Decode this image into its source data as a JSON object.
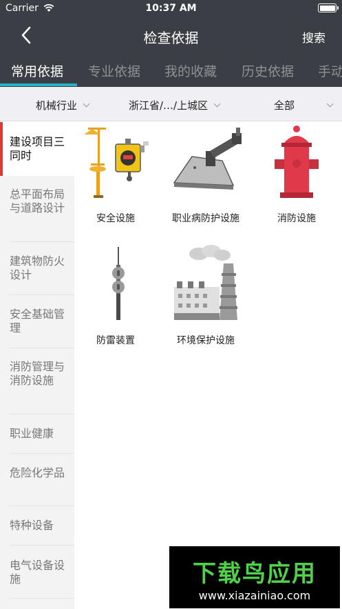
{
  "status": {
    "carrier": "Carrier",
    "time": "10:37 AM"
  },
  "nav": {
    "title": "检查依据",
    "search": "搜索"
  },
  "tabs": [
    "常用依据",
    "专业依据",
    "我的收藏",
    "历史依据",
    "手动"
  ],
  "filters": [
    "机械行业",
    "浙江省/…/上城区",
    "全部"
  ],
  "sidebar": [
    "建设项目三同时",
    "总平面布局与道路设计",
    "建筑物防火设计",
    "安全基础管理",
    "消防管理与消防设施",
    "职业健康",
    "危险化学品",
    "特种设备",
    "电气设备设施"
  ],
  "grid": [
    "安全设施",
    "职业病防护设施",
    "消防设施",
    "防雷装置",
    "环境保护设施"
  ],
  "watermark": {
    "brand": "下载鸟应用",
    "url": "www.xiazainiao.com"
  },
  "colors": {
    "bar": "#3b3e44",
    "tab_indicator": "#23b4c8",
    "active_marker": "#e53535"
  }
}
